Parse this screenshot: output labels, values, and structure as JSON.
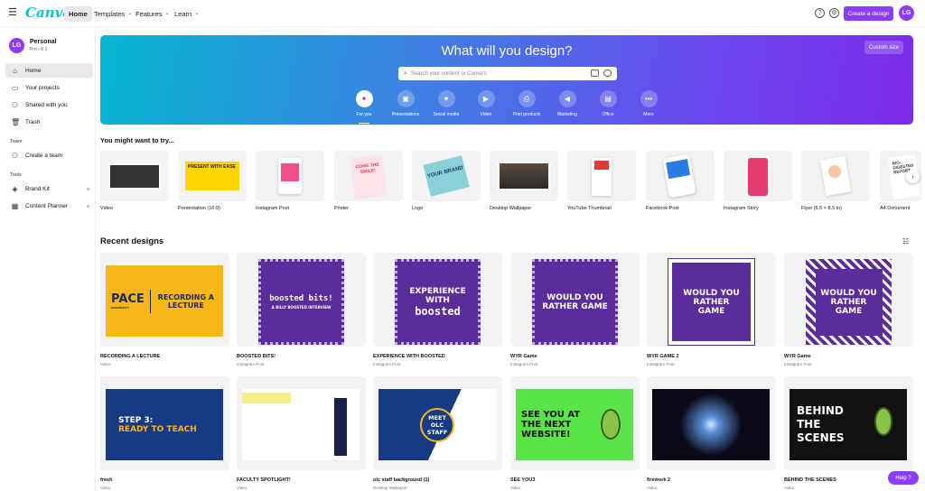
{
  "topbar": {
    "logo": "Canva",
    "nav": [
      {
        "label": "Home"
      },
      {
        "label": "Templates",
        "chevron": "⌄"
      },
      {
        "label": "Features",
        "chevron": "⌄"
      },
      {
        "label": "Learn",
        "chevron": "⌄"
      }
    ],
    "create_label": "Create a design",
    "avatar_initials": "LG"
  },
  "sidebar": {
    "account_name": "Personal",
    "account_sub": "Pro • 8 1",
    "avatar_initials": "LG",
    "items": [
      {
        "label": "Home"
      },
      {
        "label": "Your projects"
      },
      {
        "label": "Shared with you"
      },
      {
        "label": "Trash"
      }
    ],
    "team_heading": "Team",
    "team_items": [
      {
        "label": "Create a team"
      }
    ],
    "tools_heading": "Tools",
    "tools_items": [
      {
        "label": "Brand Kit"
      },
      {
        "label": "Content Planner"
      }
    ]
  },
  "hero": {
    "title": "What will you design?",
    "custom_size": "Custom size",
    "search_placeholder": "Search your content or Canva's",
    "categories": [
      {
        "label": "For you"
      },
      {
        "label": "Presentations"
      },
      {
        "label": "Social media"
      },
      {
        "label": "Video"
      },
      {
        "label": "Print products"
      },
      {
        "label": "Marketing"
      },
      {
        "label": "Office"
      },
      {
        "label": "More"
      }
    ]
  },
  "try_section": {
    "title": "You might want to try...",
    "items": [
      {
        "label": "Video"
      },
      {
        "label": "Presentation (16:9)",
        "thumb_text": "PRESENT WITH EASE"
      },
      {
        "label": "Instagram Post"
      },
      {
        "label": "Poster",
        "thumb_text": "COME THE SMILE!"
      },
      {
        "label": "Logo",
        "thumb_text": "YOUR BRAND"
      },
      {
        "label": "Desktop Wallpaper"
      },
      {
        "label": "YouTube Thumbnail"
      },
      {
        "label": "Facebook Post"
      },
      {
        "label": "Instagram Story"
      },
      {
        "label": "Flyer (5.5 × 8.5 in)"
      },
      {
        "label": "A4 Document",
        "thumb_text": "BIO-DIGESTED REPORT"
      }
    ]
  },
  "recent": {
    "title": "Recent designs",
    "row1": [
      {
        "title": "RECORDING A LECTURE",
        "type": "Video",
        "thumb_left": "PACE",
        "thumb_left_sub": "UNIVERSITY",
        "thumb_right": "RECORDING A LECTURE"
      },
      {
        "title": "BOOSTED BITS!",
        "type": "Instagram Post",
        "thumb": "boosted bits!",
        "thumb_sub": "A BILLY BOOSTED INTERVIEW"
      },
      {
        "title": "EXPERIENCE WITH BOOSTED",
        "type": "Instagram Post",
        "thumb": "EXPERIENCE WITH",
        "thumb_sub": "boosted"
      },
      {
        "title": "WYR Game",
        "type": "Instagram Post",
        "thumb": "WOULD YOU RATHER GAME"
      },
      {
        "title": "WYR GAME 2",
        "type": "Instagram Post",
        "thumb": "WOULD YOU RATHER GAME"
      },
      {
        "title": "WYR Game",
        "type": "Instagram Post",
        "thumb": "WOULD YOU RATHER GAME"
      }
    ],
    "row2": [
      {
        "title": "fresh",
        "type": "Video",
        "thumb": "STEP 3:",
        "thumb_sub": "READY TO TEACH"
      },
      {
        "title": "FACULTY SPOTLIGHT!",
        "type": "Video"
      },
      {
        "title": "olc staff background (1)",
        "type": "Desktop Wallpaper",
        "thumb": "MEET OLC STAFF"
      },
      {
        "title": "SEE YOU3",
        "type": "Video",
        "thumb": "SEE YOU AT THE NEXT WEBSITE!"
      },
      {
        "title": "firework 2",
        "type": "Video"
      },
      {
        "title": "BEHIND THE SCENES",
        "type": "Video",
        "thumb": "BEHIND THE SCENES"
      }
    ]
  },
  "help_label": "Help ?",
  "colors": {
    "accent": "#8b3dff",
    "logo": "#00c4cc",
    "hero_start": "#06b6d0",
    "hero_end": "#7d2ae8"
  }
}
